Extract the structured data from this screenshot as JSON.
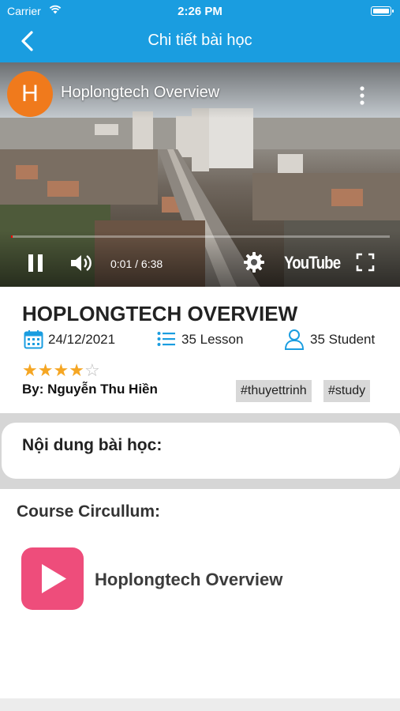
{
  "status_bar": {
    "carrier": "Carrier",
    "time": "2:26 PM"
  },
  "nav": {
    "title": "Chi tiết bài học",
    "back_icon": "chevron-left-icon"
  },
  "video": {
    "channel_initial": "H",
    "title": "Hoplongtech Overview",
    "time": "0:01 / 6:38",
    "brand": "YouTube",
    "progress_fraction": 0.003,
    "avatar_color": "#f07a1c"
  },
  "course": {
    "title": "HOPLONGTECH OVERVIEW",
    "date": "24/12/2021",
    "lessons": "35 Lesson",
    "students": "35 Student",
    "rating": 4,
    "rating_max": 5,
    "author": "By: Nguyễn Thu Hiền",
    "tags": [
      "#thuyettrinh",
      "#study"
    ]
  },
  "content": {
    "heading": "Nội dung bài học:"
  },
  "curriculum": {
    "heading": "Course Circullum:",
    "items": [
      {
        "title": "Hoplongtech Overview"
      }
    ]
  },
  "colors": {
    "primary": "#1a9de0",
    "star": "#f5a623",
    "play_tile": "#ee4d7b"
  }
}
